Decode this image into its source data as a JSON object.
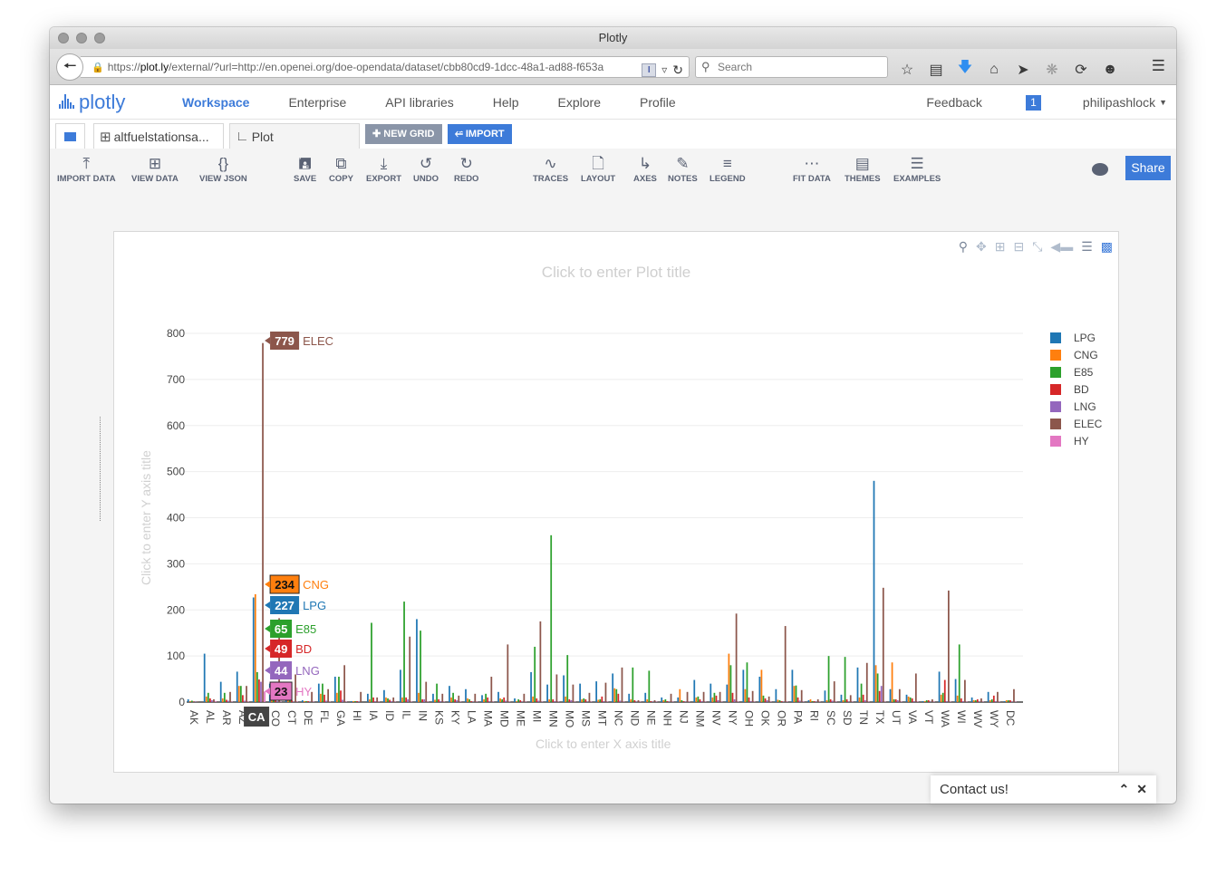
{
  "browser": {
    "window_title": "Plotly",
    "url_host": "plot.ly",
    "url_prefix": "https://",
    "url_path": "/external/?url=http://en.openei.org/doe-opendata/dataset/cbb80cd9-1dcc-48a1-ad88-f653a",
    "search_placeholder": "Search",
    "icons": [
      "star-icon",
      "reading-list-icon",
      "download-icon",
      "home-icon",
      "send-icon",
      "extension-icon",
      "history-icon",
      "smiley-icon"
    ]
  },
  "navbar": {
    "logo_text": "plotly",
    "links": [
      {
        "label": "Workspace",
        "active": true
      },
      {
        "label": "Enterprise",
        "active": false
      },
      {
        "label": "API libraries",
        "active": false
      },
      {
        "label": "Help",
        "active": false
      },
      {
        "label": "Explore",
        "active": false
      },
      {
        "label": "Profile",
        "active": false
      }
    ],
    "feedback": "Feedback",
    "notification_count": "1",
    "username": "philipashlock"
  },
  "tabs": {
    "grid_tab": "altfuelstationsa...",
    "plot_tab": "Plot",
    "new_grid": "NEW GRID",
    "import": "IMPORT"
  },
  "toolbar": {
    "groups": [
      [
        {
          "label": "IMPORT DATA",
          "icon": "upload-icon"
        },
        {
          "label": "VIEW DATA",
          "icon": "grid-icon"
        },
        {
          "label": "VIEW JSON",
          "icon": "braces-icon"
        }
      ],
      [
        {
          "label": "SAVE",
          "icon": "save-icon"
        },
        {
          "label": "COPY",
          "icon": "copy-icon"
        },
        {
          "label": "EXPORT",
          "icon": "download-icon"
        },
        {
          "label": "UNDO",
          "icon": "undo-icon"
        },
        {
          "label": "REDO",
          "icon": "redo-icon"
        }
      ],
      [
        {
          "label": "TRACES",
          "icon": "traces-icon"
        },
        {
          "label": "LAYOUT",
          "icon": "file-icon"
        },
        {
          "label": "AXES",
          "icon": "axes-icon"
        },
        {
          "label": "NOTES",
          "icon": "pencil-icon"
        },
        {
          "label": "LEGEND",
          "icon": "list-icon"
        }
      ],
      [
        {
          "label": "FIT DATA",
          "icon": "fit-data-icon"
        },
        {
          "label": "THEMES",
          "icon": "paint-roller-icon"
        },
        {
          "label": "EXAMPLES",
          "icon": "examples-icon"
        }
      ]
    ],
    "share": "Share"
  },
  "plot": {
    "title_placeholder": "Click to enter Plot title",
    "xaxis_placeholder": "Click to enter X axis title",
    "yaxis_placeholder": "Click to enter Y axis title",
    "hover_category": "CA"
  },
  "contact": {
    "label": "Contact us!"
  },
  "chart_data": {
    "type": "bar",
    "title": "",
    "xlabel": "",
    "ylabel": "",
    "ylim": [
      0,
      800
    ],
    "yticks": [
      0,
      100,
      200,
      300,
      400,
      500,
      600,
      700,
      800
    ],
    "grid": true,
    "legend_position": "right",
    "categories": [
      "AK",
      "AL",
      "AR",
      "AZ",
      "CA",
      "CO",
      "CT",
      "DE",
      "FL",
      "GA",
      "HI",
      "IA",
      "ID",
      "IL",
      "IN",
      "KS",
      "KY",
      "LA",
      "MA",
      "MD",
      "ME",
      "MI",
      "MN",
      "MO",
      "MS",
      "MT",
      "NC",
      "ND",
      "NE",
      "NH",
      "NJ",
      "NM",
      "NV",
      "NY",
      "OH",
      "OK",
      "OR",
      "PA",
      "RI",
      "SC",
      "SD",
      "TN",
      "TX",
      "UT",
      "VA",
      "VT",
      "WA",
      "WI",
      "WV",
      "WY",
      "DC"
    ],
    "series": [
      {
        "name": "LPG",
        "color": "#1f77b4",
        "values": [
          6,
          105,
          44,
          66,
          227,
          40,
          25,
          4,
          40,
          55,
          2,
          18,
          26,
          70,
          180,
          18,
          35,
          28,
          15,
          22,
          8,
          65,
          38,
          58,
          40,
          45,
          62,
          18,
          20,
          10,
          10,
          48,
          40,
          38,
          70,
          55,
          28,
          70,
          4,
          25,
          16,
          75,
          480,
          28,
          16,
          2,
          66,
          50,
          10,
          22,
          2
        ]
      },
      {
        "name": "CNG",
        "color": "#ff7f0e",
        "values": [
          2,
          12,
          8,
          35,
          234,
          30,
          15,
          2,
          18,
          20,
          2,
          6,
          10,
          10,
          20,
          5,
          10,
          8,
          6,
          8,
          2,
          12,
          6,
          12,
          6,
          5,
          30,
          6,
          6,
          4,
          28,
          10,
          10,
          105,
          28,
          70,
          5,
          35,
          6,
          4,
          4,
          10,
          80,
          86,
          12,
          2,
          16,
          14,
          4,
          4,
          4
        ]
      },
      {
        "name": "E85",
        "color": "#2ca02c",
        "values": [
          3,
          20,
          20,
          35,
          65,
          20,
          4,
          2,
          40,
          55,
          2,
          172,
          8,
          218,
          155,
          40,
          20,
          6,
          18,
          6,
          6,
          120,
          362,
          102,
          8,
          6,
          28,
          75,
          68,
          6,
          4,
          12,
          20,
          80,
          86,
          14,
          4,
          36,
          2,
          100,
          98,
          40,
          62,
          6,
          10,
          4,
          20,
          125,
          4,
          6,
          4
        ]
      },
      {
        "name": "BD",
        "color": "#d62728",
        "values": [
          1,
          8,
          5,
          15,
          49,
          10,
          4,
          2,
          16,
          25,
          2,
          10,
          5,
          10,
          6,
          6,
          6,
          2,
          10,
          10,
          4,
          8,
          6,
          6,
          6,
          12,
          18,
          4,
          2,
          2,
          2,
          6,
          14,
          20,
          10,
          8,
          2,
          10,
          2,
          6,
          6,
          16,
          24,
          6,
          8,
          4,
          48,
          8,
          6,
          14,
          4
        ]
      },
      {
        "name": "LNG",
        "color": "#9467bd",
        "values": [
          1,
          4,
          3,
          3,
          44,
          2,
          1,
          1,
          3,
          5,
          1,
          2,
          2,
          6,
          6,
          2,
          4,
          1,
          2,
          3,
          1,
          3,
          2,
          4,
          1,
          2,
          3,
          1,
          1,
          1,
          1,
          2,
          4,
          6,
          2,
          4,
          1,
          3,
          1,
          3,
          1,
          4,
          35,
          4,
          2,
          1,
          2,
          2,
          1,
          2,
          1
        ]
      },
      {
        "name": "ELEC",
        "color": "#8c564b",
        "values": [
          1,
          6,
          22,
          35,
          779,
          182,
          60,
          22,
          28,
          80,
          22,
          10,
          10,
          142,
          44,
          18,
          14,
          18,
          55,
          125,
          18,
          175,
          60,
          38,
          20,
          42,
          75,
          4,
          4,
          18,
          22,
          22,
          22,
          192,
          24,
          12,
          165,
          26,
          6,
          45,
          15,
          85,
          248,
          28,
          62,
          6,
          242,
          48,
          8,
          22,
          28
        ]
      },
      {
        "name": "HY",
        "color": "#e377c2",
        "values": [
          0,
          2,
          1,
          1,
          23,
          1,
          1,
          1,
          1,
          1,
          0,
          1,
          1,
          1,
          1,
          1,
          1,
          1,
          1,
          1,
          1,
          1,
          1,
          1,
          1,
          1,
          1,
          1,
          1,
          1,
          1,
          1,
          1,
          1,
          1,
          1,
          1,
          1,
          1,
          1,
          1,
          1,
          1,
          1,
          1,
          1,
          1,
          1,
          1,
          1,
          1
        ]
      }
    ],
    "hover": {
      "category": "CA",
      "labels": [
        {
          "series": "ELEC",
          "value": "779"
        },
        {
          "series": "CNG",
          "value": "234"
        },
        {
          "series": "LPG",
          "value": "227"
        },
        {
          "series": "E85",
          "value": "65"
        },
        {
          "series": "BD",
          "value": "49"
        },
        {
          "series": "LNG",
          "value": "44"
        },
        {
          "series": "HY",
          "value": "23"
        }
      ]
    }
  }
}
